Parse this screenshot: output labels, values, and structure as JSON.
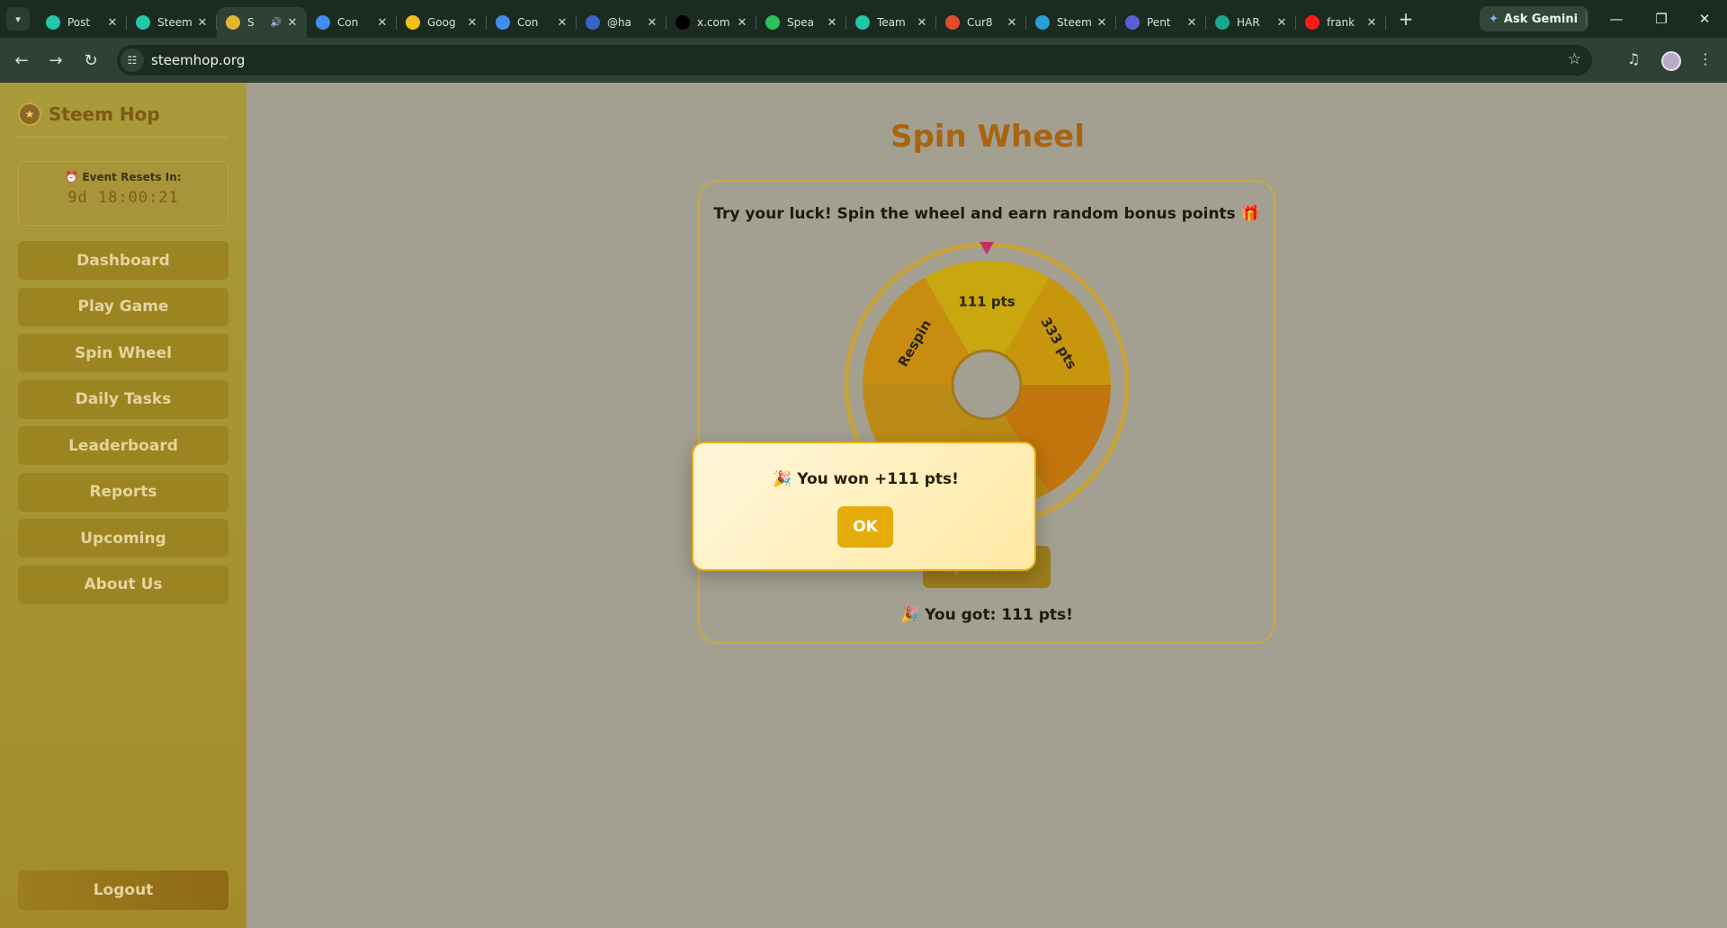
{
  "browser": {
    "tabs": [
      {
        "title": "Post",
        "favicon_color": "#21c7a8",
        "active": false
      },
      {
        "title": "Steem",
        "favicon_color": "#21c7a8",
        "active": false
      },
      {
        "title": "S",
        "favicon_color": "#e2b52f",
        "active": true,
        "audio": true
      },
      {
        "title": "Con",
        "favicon_color": "#3f8ef0",
        "active": false
      },
      {
        "title": "Goog",
        "favicon_color": "#f6c01b",
        "active": false
      },
      {
        "title": "Con",
        "favicon_color": "#3f8ef0",
        "active": false
      },
      {
        "title": "@ha",
        "favicon_color": "#3a63c8",
        "active": false
      },
      {
        "title": "x.com",
        "favicon_color": "#000000",
        "active": false
      },
      {
        "title": "Spea",
        "favicon_color": "#2ac35a",
        "active": false
      },
      {
        "title": "Team",
        "favicon_color": "#21c7a8",
        "active": false
      },
      {
        "title": "Cur8",
        "favicon_color": "#e54a2a",
        "active": false
      },
      {
        "title": "Steem",
        "favicon_color": "#2a9fd6",
        "active": false
      },
      {
        "title": "Pent",
        "favicon_color": "#5b5fd6",
        "active": false
      },
      {
        "title": "HAR",
        "favicon_color": "#18a88a",
        "active": false
      },
      {
        "title": "frank",
        "favicon_color": "#ff1a1a",
        "active": false
      }
    ],
    "gemini_label": "Ask Gemini",
    "url": "steemhop.org"
  },
  "sidebar": {
    "brand": "Steem Hop",
    "timer_label": "⏰ Event Resets In:",
    "timer_value": "9d 18:00:21",
    "nav": [
      {
        "label": "Dashboard"
      },
      {
        "label": "Play Game"
      },
      {
        "label": "Spin Wheel"
      },
      {
        "label": "Daily Tasks"
      },
      {
        "label": "Leaderboard"
      },
      {
        "label": "Reports"
      },
      {
        "label": "Upcoming"
      },
      {
        "label": "About Us"
      }
    ],
    "logout": "Logout"
  },
  "main": {
    "title": "Spin Wheel",
    "subtitle": "Try your luck! Spin the wheel and earn random bonus points 🎁",
    "wheel_segments": [
      {
        "label": "111 pts",
        "color": "#c9a70f"
      },
      {
        "label": "333 pts",
        "color": "#c7960d"
      },
      {
        "label": "",
        "color": "#c2750c"
      },
      {
        "label": "",
        "color": "#b98a14"
      },
      {
        "label": "",
        "color": "#bb8b18"
      },
      {
        "label": "Respin",
        "color": "#c88c10"
      }
    ],
    "spin_button": "Spin Now!",
    "result_text": "🎉 You got: 111 pts!"
  },
  "modal": {
    "message": "🎉 You won +111 pts!",
    "ok": "OK"
  },
  "colors": {
    "accent": "#e5ac0b",
    "title": "#a8640f",
    "pointer": "#c2306a"
  }
}
